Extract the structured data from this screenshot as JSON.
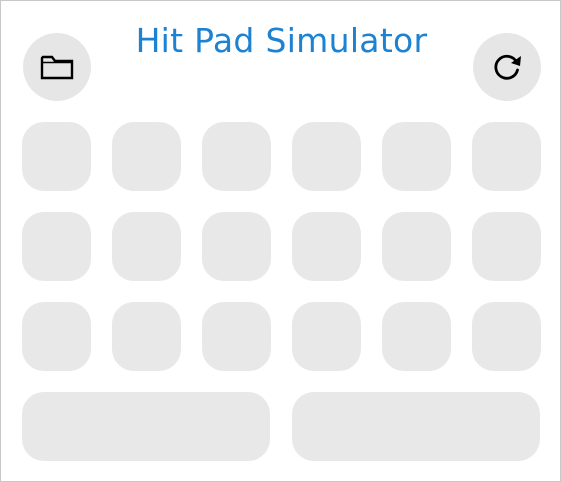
{
  "app": {
    "title": "Hit Pad Simulator"
  },
  "toolbar": {
    "open_icon": "folder-icon",
    "reset_icon": "refresh-icon"
  },
  "pads": {
    "rows": 3,
    "columns": 6,
    "bottom_wide_pads": 2
  },
  "colors": {
    "title": "#1e82d2",
    "pad": "#e8e8e8",
    "button": "#e6e6e6",
    "icon": "#000000"
  }
}
